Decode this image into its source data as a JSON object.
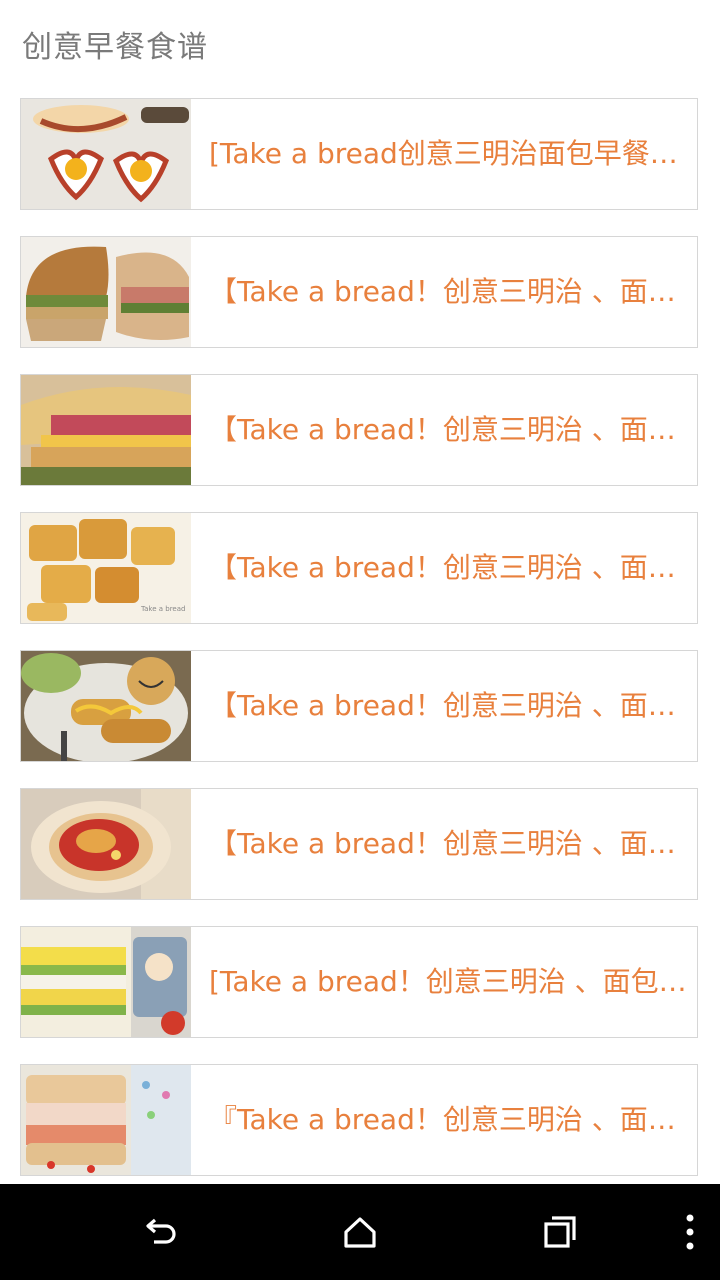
{
  "header": {
    "title": "创意早餐食谱"
  },
  "items": [
    {
      "title": "[Take a bread创意三明治面包早餐…",
      "image": "egg-heart-sausage-photo"
    },
    {
      "title": "【Take a bread！创意三明治 、面…",
      "image": "sandwich-photo"
    },
    {
      "title": "【Take a bread！创意三明治 、面…",
      "image": "ham-cheese-toast-photo"
    },
    {
      "title": "【Take a bread！创意三明治 、面…",
      "image": "french-toast-photo"
    },
    {
      "title": "【Take a bread！创意三明治 、面…",
      "image": "rolled-bread-photo"
    },
    {
      "title": "【Take a bread！创意三明治 、面…",
      "image": "pizza-toast-photo"
    },
    {
      "title": "[Take a bread！创意三明治 、面包…",
      "image": "egg-sandwich-photo"
    },
    {
      "title": "『Take a bread！创意三明治 、面…",
      "image": "cream-sandwich-photo"
    }
  ],
  "navbar": {
    "back": "back-icon",
    "home": "home-icon",
    "recents": "recents-icon",
    "menu": "more-vert-icon"
  },
  "colors": {
    "title_text": "#7a7a7a",
    "item_text": "#e8803d",
    "border": "#d6d6d6",
    "navbar": "#000000"
  }
}
